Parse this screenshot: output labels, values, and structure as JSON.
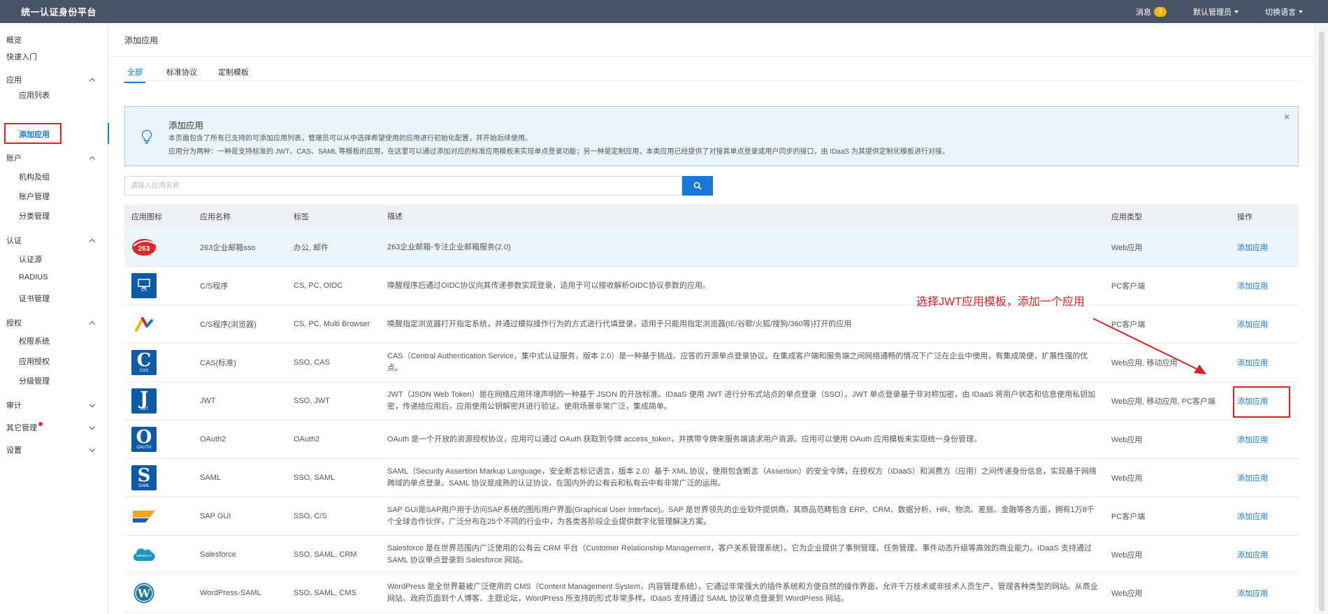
{
  "topbar": {
    "brand": "统一认证身份平台",
    "messages_label": "消息",
    "messages_count": "3",
    "admin_label": "默认管理员",
    "language_label": "切换语言"
  },
  "sidebar": {
    "overview": "概览",
    "quickstart": "快速入门",
    "groups": {
      "app": "应用",
      "account": "账户",
      "auth": "认证",
      "permission": "授权",
      "audit": "审计",
      "other": "其它管理",
      "settings": "设置"
    },
    "subs": {
      "app_list": "应用列表",
      "add_app": "添加应用",
      "org": "机构及组",
      "account_mgmt": "账户管理",
      "category": "分类管理",
      "auth_source": "认证源",
      "radius": "RADIUS",
      "cert": "证书管理",
      "perm_system": "权限系统",
      "app_auth": "应用授权",
      "level_mgmt": "分级管理"
    }
  },
  "main": {
    "page_title": "添加应用",
    "tabs": [
      "全部",
      "标准协议",
      "定制模板"
    ],
    "info": {
      "title": "添加应用",
      "line1": "本页面包含了所有已支持的可添加应用列表，管理员可以从中选择希望使用的应用进行初始化配置，并开始后续使用。",
      "line2": "应用分为两种：一种是支持标准的 JWT、CAS、SAML 等模板的应用，在这里可以通过添加对应的标准应用模板来实现单点登录功能；另一种是定制应用，本类应用已经提供了对接其单点登录或用户同步的接口，由 IDaaS 为其提供定制化模板进行对接。"
    },
    "search_placeholder": "请输入应用名称",
    "table": {
      "headers": {
        "icon": "应用图标",
        "name": "应用名称",
        "tags": "标签",
        "desc": "描述",
        "type": "应用类型",
        "op": "操作"
      },
      "op_label": "添加应用",
      "rows": [
        {
          "name": "263企业邮箱sso",
          "tags": "办公, 邮件",
          "desc": "263企业邮箱-专注企业邮箱服务(2.0)",
          "type": "Web应用"
        },
        {
          "name": "C/S程序",
          "tags": "CS, PC, OIDC",
          "desc": "唤醒程序后通过OIDC协议向其传递参数实现登录，适用于可以接收解析OIDC协议参数的应用。",
          "type": "PC客户端"
        },
        {
          "name": "C/S程序(浏览器)",
          "tags": "CS, PC, Multi Browser",
          "desc": "唤醒指定浏览器打开指定系统，并通过模拟操作行为的方式进行代填登录，适用于只能用指定浏览器(IE/谷歌/火狐/搜狗/360等)打开的应用",
          "type": "PC客户端"
        },
        {
          "name": "CAS(标准)",
          "tags": "SSO, CAS",
          "desc": "CAS（Central Authentication Service，集中式认证服务，版本 2.0）是一种基于挑战、应答的开源单点登录协议。在集成客户端和服务端之间网络通畅的情况下广泛在企业中使用，有集成简便，扩展性强的优点。",
          "type": "Web应用, 移动应用"
        },
        {
          "name": "JWT",
          "tags": "SSO, JWT",
          "desc": "JWT（JSON Web Token）是在网络应用环境声明的一种基于 JSON 的开放标准。IDaaS 使用 JWT 进行分布式站点的单点登录（SSO）。JWT 单点登录基于非对称加密，由 IDaaS 将用户状态和信息使用私钥加密，传递给应用后，应用使用公钥解密并进行验证。使用场景非常广泛，集成简单。",
          "type": "Web应用, 移动应用, PC客户端"
        },
        {
          "name": "OAuth2",
          "tags": "OAuth2",
          "desc": "OAuth 是一个开放的资源授权协议，应用可以通过 OAuth 获取到令牌 access_token，并携带令牌来服务端请求用户资源。应用可以使用 OAuth 应用模板来实现统一身份管理。",
          "type": "Web应用"
        },
        {
          "name": "SAML",
          "tags": "SSO, SAML",
          "desc": "SAML（Security Assertion Markup Language，安全断言标记语言，版本 2.0）基于 XML 协议，使用包含断言（Assertion）的安全令牌，在授权方（IDaaS）和消费方（应用）之间传递身份信息，实现基于网络跨域的单点登录。SAML 协议是成熟的认证协议，在国内外的公有云和私有云中有非常广泛的运用。",
          "type": "Web应用"
        },
        {
          "name": "SAP GUI",
          "tags": "SSO, C/S",
          "desc": "SAP GUI是SAP用户用于访问SAP系统的图形用户界面(Graphical User Interface)。SAP 是世界领先的企业软件提供商，其商品范畴包含 ERP、CRM、数据分析、HR、物流、差旅、金融等各方面，拥有1万8千个全球合作伙伴，广泛分布在25个不同的行业中，为各类各阶段企业提供数字化管理解决方案。",
          "type": "PC客户端"
        },
        {
          "name": "Salesforce",
          "tags": "SSO, SAML, CRM",
          "desc": "Salesforce 是在世界范围内广泛使用的公有云 CRM 平台（Customer Relationship Management，客户关系管理系统）。它为企业提供了事例管理、任务管理、事件动态升级等高效的商业能力。IDaaS 支持通过 SAML 协议单点登录到 Salesforce 网站。",
          "type": "Web应用"
        },
        {
          "name": "WordPress-SAML",
          "tags": "SSO, SAML, CMS",
          "desc": "WordPress 是全世界最被广泛使用的 CMS（Content Management System，内容管理系统）。它通过非常强大的插件系统和方便自然的操作界面，允许千万技术或非技术人员生产、管理各种类型的网站。从商业网站、政府页面到个人博客、主题论坛，WordPress 所支持的形式非常多样。IDaaS 支持通过 SAML 协议单点登录到 WordPress 网站。",
          "type": "Web应用"
        }
      ]
    }
  },
  "icon_text": {
    "logo_263": "263",
    "cs": "CS",
    "cas": "CAS",
    "jwt": "JWT",
    "oauth": "OAUTH",
    "saml": "SAML",
    "salesforce": "salesforce"
  },
  "annotation": {
    "text": "选择JWT应用模板，添加一个应用"
  },
  "colors": {
    "topbar": "#4a5468",
    "accent": "#1877d4",
    "annotation": "#e02020",
    "badge": "#f5b400"
  }
}
